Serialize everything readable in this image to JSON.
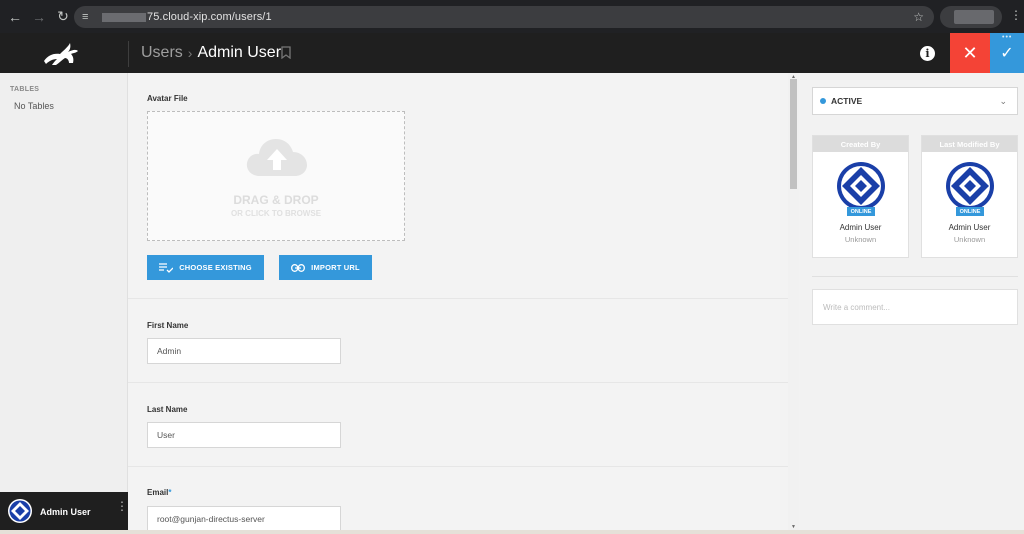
{
  "browser": {
    "url_visible": "75.cloud-xip.com/users/1",
    "back_icon": "arrow-left-icon",
    "forward_icon": "arrow-right-icon",
    "reload_icon": "reload-icon"
  },
  "header": {
    "section": "Users",
    "title": "Admin User"
  },
  "sidebar": {
    "heading": "TABLES",
    "empty_text": "No Tables",
    "user_name": "Admin User"
  },
  "form": {
    "avatar_label": "Avatar File",
    "dropzone_title": "DRAG & DROP",
    "dropzone_sub": "OR CLICK TO BROWSE",
    "choose_existing": "CHOOSE EXISTING",
    "import_url": "IMPORT URL",
    "first_name_label": "First Name",
    "first_name_value": "Admin",
    "last_name_label": "Last Name",
    "last_name_value": "User",
    "email_label": "Email",
    "email_required": "*",
    "email_value": "root@gunjan-directus-server"
  },
  "info_panel": {
    "status": "ACTIVE",
    "created_by_heading": "Created By",
    "modified_by_heading": "Last Modified By",
    "online_badge": "ONLINE",
    "created_by_name": "Admin User",
    "created_by_time": "Unknown",
    "modified_by_name": "Admin User",
    "modified_by_time": "Unknown",
    "comment_placeholder": "Write a comment..."
  },
  "colors": {
    "accent": "#3498db",
    "danger": "#f44336",
    "topbar": "#1f1f1f"
  }
}
